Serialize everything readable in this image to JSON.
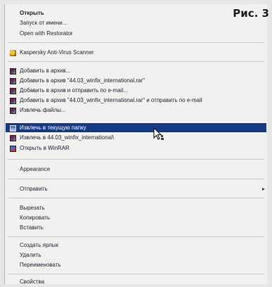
{
  "figure_label": "Рис. 3",
  "menu": {
    "items": [
      {
        "label": "Открыть",
        "bold": true
      },
      {
        "label": "Запуск от имени..."
      },
      {
        "label": "Open with Restorator"
      },
      {
        "label": "Kaspersky Anti-Virus Scanner",
        "icon": "kaspersky-icon"
      },
      {
        "label": "Добавить в архив...",
        "icon": "winrar-archive-icon"
      },
      {
        "label": "Добавить в архив \"44.03_winfix_international.rar\"",
        "icon": "winrar-archive-icon"
      },
      {
        "label": "Добавить в архив и отправить по e-mail...",
        "icon": "winrar-archive-icon"
      },
      {
        "label": "Добавить в архив \"44.03_winfix_international.rar\" и отправить по e-mail",
        "icon": "winrar-archive-icon"
      },
      {
        "label": "Извлечь файлы...",
        "icon": "winrar-archive-icon"
      },
      {
        "label": "Извлечь в текущую папку",
        "icon": "extract-icon",
        "selected": true
      },
      {
        "label": "Извлечь в 44.03_winfix_international\\",
        "icon": "winrar-archive-icon"
      },
      {
        "label": "Открыть в WinRAR",
        "icon": "winrar-icon"
      },
      {
        "label": "Appearance"
      },
      {
        "label": "Отправить",
        "submenu": true
      },
      {
        "label": "Вырезать"
      },
      {
        "label": "Копировать"
      },
      {
        "label": "Вставить"
      },
      {
        "label": "Создать ярлык"
      },
      {
        "label": "Удалить"
      },
      {
        "label": "Переименовать"
      },
      {
        "label": "Свойства"
      }
    ]
  }
}
